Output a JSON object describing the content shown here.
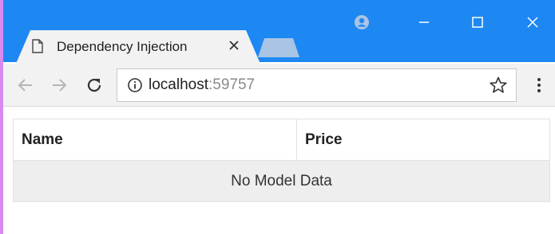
{
  "browser": {
    "tab": {
      "title": "Dependency Injection",
      "close_label": "×"
    },
    "address": {
      "host": "localhost",
      "port": ":59757"
    },
    "colors": {
      "titlebar": "#1d88f2",
      "toolbar": "#f2f2f2"
    }
  },
  "table": {
    "headers": [
      "Name",
      "Price"
    ],
    "empty_message": "No Model Data"
  }
}
